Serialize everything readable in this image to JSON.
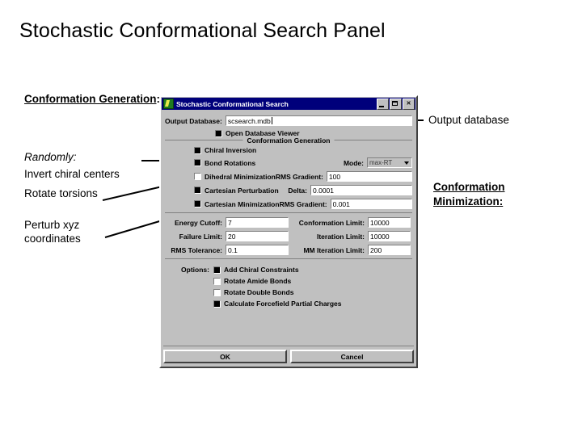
{
  "slide": {
    "title": "Stochastic Conformational Search Panel"
  },
  "annotations": {
    "conformation_generation": "Conformation Generation",
    "conformation_generation_colon": ":",
    "randomly": "Randomly:",
    "invert_chiral_centers": "Invert chiral centers",
    "rotate_torsions": "Rotate torsions",
    "perturb_xyz": "Perturb xyz\ncoordinates",
    "output_database": "Output database",
    "conformation_minimization": "Conformation Minimization:"
  },
  "dialog": {
    "title": "Stochastic Conformational Search",
    "window_buttons": {
      "minimize": "minimize-icon",
      "maximize": "maximize-icon",
      "close": "✕"
    },
    "output_database": {
      "label": "Output Database:",
      "value": "scsearch.mdb"
    },
    "open_database_viewer": {
      "label": "Open Database Viewer",
      "checked": true
    },
    "conformation_generation": {
      "caption": "Conformation Generation",
      "chiral_inversion": {
        "label": "Chiral Inversion",
        "checked": true
      },
      "bond_rotations": {
        "label": "Bond Rotations",
        "checked": true,
        "mode_label": "Mode:",
        "mode_value": "max-RT"
      },
      "dihedral_minimization": {
        "label": "Dihedral Minimization",
        "checked": false,
        "field_label": "RMS Gradient:",
        "field_value": "100"
      },
      "cartesian_perturbation": {
        "label": "Cartesian Perturbation",
        "checked": true,
        "field_label": "Delta:",
        "field_value": "0.0001"
      },
      "cartesian_minimization": {
        "label": "Cartesian Minimization",
        "checked": true,
        "field_label": "RMS Gradient:",
        "field_value": "0.001"
      }
    },
    "limits": [
      {
        "label": "Energy Cutoff:",
        "value": "7",
        "label2": "Conformation Limit:",
        "value2": "10000"
      },
      {
        "label": "Failure Limit:",
        "value": "20",
        "label2": "Iteration Limit:",
        "value2": "10000"
      },
      {
        "label": "RMS Tolerance:",
        "value": "0.1",
        "label2": "MM Iteration Limit:",
        "value2": "200"
      }
    ],
    "options": {
      "label": "Options:",
      "items": [
        {
          "label": "Add Chiral Constraints",
          "checked": true
        },
        {
          "label": "Rotate Amide Bonds",
          "checked": false
        },
        {
          "label": "Rotate Double Bonds",
          "checked": false
        },
        {
          "label": "Calculate Forcefield Partial Charges",
          "checked": true
        }
      ]
    },
    "buttons": {
      "ok": "OK",
      "cancel": "Cancel"
    }
  },
  "colors": {
    "titlebar": "#00007b",
    "dialog_face": "#c0c0c0",
    "field_bg": "#ffffff",
    "page_bg": "#ffffff",
    "text": "#000000"
  }
}
